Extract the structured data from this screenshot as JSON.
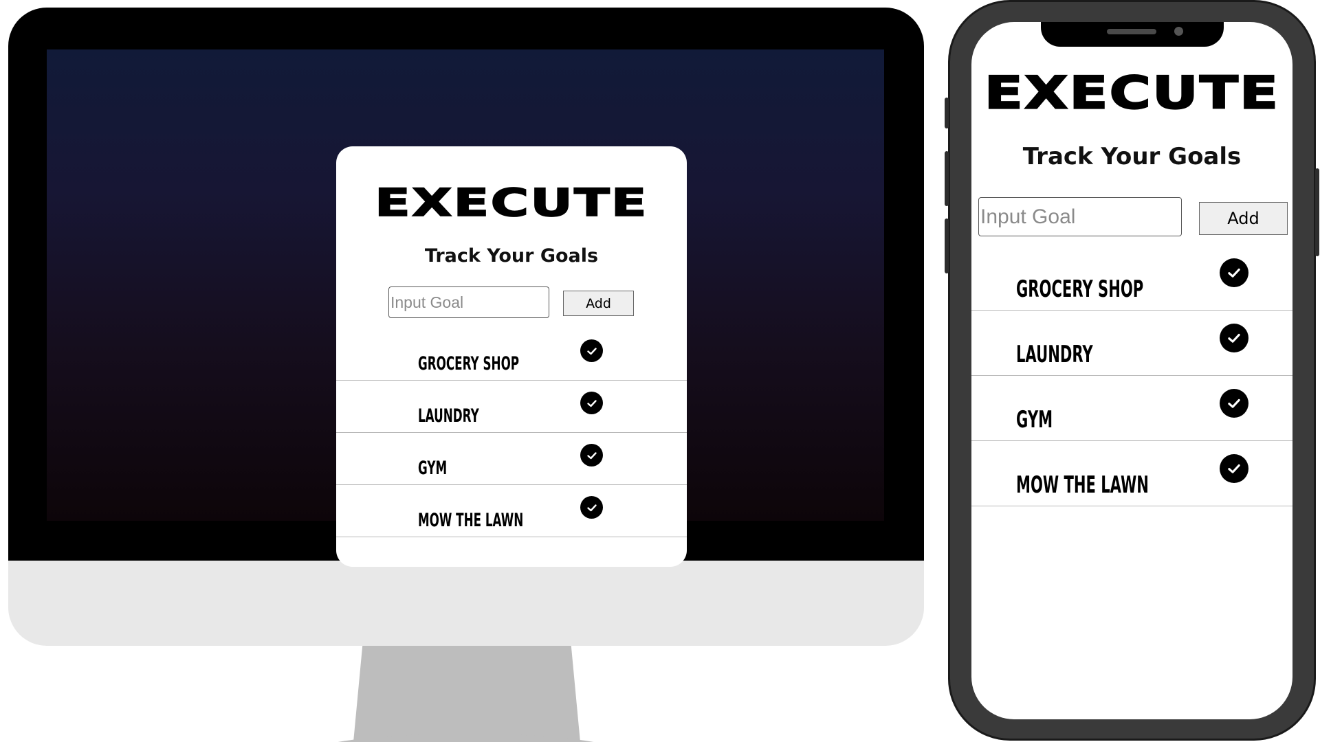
{
  "app": {
    "title": "EXECUTE",
    "subtitle": "Track Your Goals"
  },
  "form": {
    "input_placeholder": "Input Goal",
    "input_value": "",
    "add_label": "Add"
  },
  "goals": [
    {
      "label": "GROCERY SHOP"
    },
    {
      "label": "LAUNDRY"
    },
    {
      "label": "GYM"
    },
    {
      "label": "MOW THE LAWN"
    }
  ],
  "icons": {
    "complete": "check-circle-icon"
  },
  "colors": {
    "background_top": "#111a38",
    "background_bottom": "#0d0509",
    "card": "#ffffff",
    "text": "#000000",
    "check_fill": "#000000",
    "check_mark": "#ffffff",
    "device_frame": "#000000",
    "monitor_chin": "#e8e8e8",
    "monitor_stand": "#bdbdbd"
  }
}
